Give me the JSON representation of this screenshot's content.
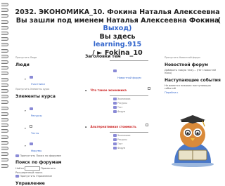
{
  "header": {
    "line1": "2032. ЭКОНОМИКА_10. Фокина Наталья Алексеевна",
    "line2": "Вы зашли под именем Наталья Алексеевна Фокина",
    "paren": "(",
    "logout": "Выход)",
    "line4": "Вы здесь",
    "site": "learning.915",
    "breadcrumb": "/ ► Fokina_10"
  },
  "left": {
    "skip_people": "Пропустить Люди",
    "people_title": "Люди",
    "participants": "Участники",
    "skip_elements": "Пропустить Элементы курса",
    "elements_title": "Элементы курса",
    "resources": "Ресурсы",
    "tests": "Тесты",
    "forums": "Форумы",
    "skip_search": "Пропустить Поиск по форумам",
    "search_title": "Поиск по форумам",
    "find_label": "Найти",
    "go_button": "Применить",
    "advanced_search": "Расширенный поиск",
    "skip_management": "Пропустить Управление",
    "management_title": "Управление"
  },
  "center": {
    "topics_title": "Заголовки тем",
    "news_forum": "Новостной форум",
    "what_is_economics": "Что такое экономика",
    "alternative_cost": "Альтернативная стоимость",
    "item_a": "Экономика",
    "item_b": "Ресурсы",
    "item_c": "Тест",
    "item_d": "Форум"
  },
  "right": {
    "skip_news": "Пропустить Новостной форум",
    "news_title": "Новостной форум",
    "news_text": "Добавить новую тему... (Нет новостей пока)",
    "upcoming_title": "Наступающие события",
    "upcoming_text": "Не имеется никаких наступающих событий",
    "go_calendar": "Перейти к"
  },
  "colors": {
    "accent": "#3366cc",
    "alert": "#cc2222"
  }
}
